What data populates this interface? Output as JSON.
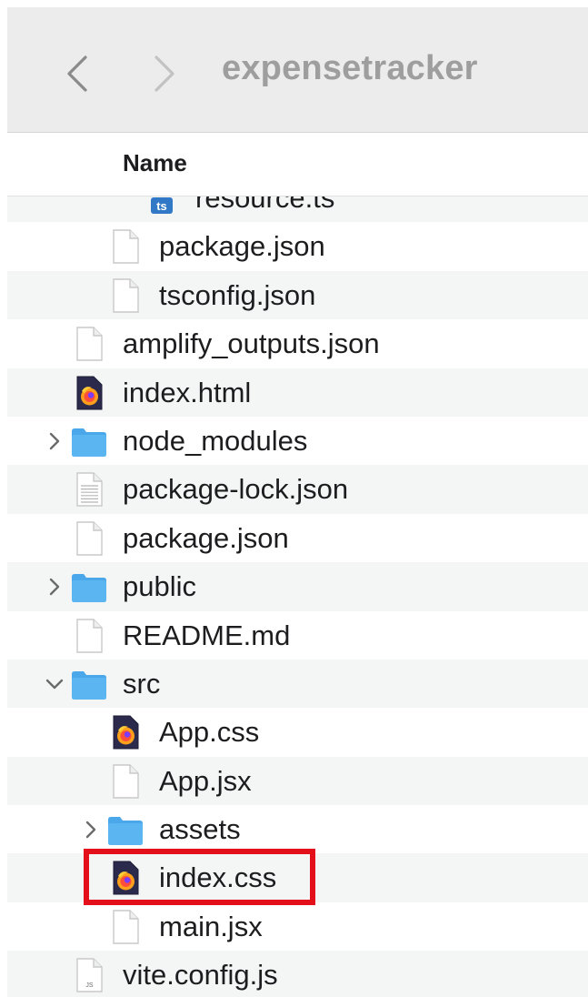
{
  "window": {
    "title": "expensetracker"
  },
  "list_header": {
    "name_label": "Name"
  },
  "files": [
    {
      "name": "resource.ts",
      "depth": 2,
      "icon": "typescript-file-icon",
      "expandable": false
    },
    {
      "name": "package.json",
      "depth": 1,
      "icon": "document-icon",
      "expandable": false
    },
    {
      "name": "tsconfig.json",
      "depth": 1,
      "icon": "document-icon",
      "expandable": false
    },
    {
      "name": "amplify_outputs.json",
      "depth": 0,
      "icon": "document-icon",
      "expandable": false
    },
    {
      "name": "index.html",
      "depth": 0,
      "icon": "firefox-file-icon",
      "expandable": false
    },
    {
      "name": "node_modules",
      "depth": 0,
      "icon": "folder-icon",
      "expandable": true,
      "expanded": false
    },
    {
      "name": "package-lock.json",
      "depth": 0,
      "icon": "text-document-icon",
      "expandable": false
    },
    {
      "name": "package.json",
      "depth": 0,
      "icon": "document-icon",
      "expandable": false
    },
    {
      "name": "public",
      "depth": 0,
      "icon": "folder-icon",
      "expandable": true,
      "expanded": false
    },
    {
      "name": "README.md",
      "depth": 0,
      "icon": "document-icon",
      "expandable": false
    },
    {
      "name": "src",
      "depth": 0,
      "icon": "folder-icon",
      "expandable": true,
      "expanded": true
    },
    {
      "name": "App.css",
      "depth": 1,
      "icon": "firefox-file-icon",
      "expandable": false
    },
    {
      "name": "App.jsx",
      "depth": 1,
      "icon": "document-icon",
      "expandable": false
    },
    {
      "name": "assets",
      "depth": 1,
      "icon": "folder-icon",
      "expandable": true,
      "expanded": false
    },
    {
      "name": "index.css",
      "depth": 1,
      "icon": "firefox-file-icon",
      "expandable": false,
      "highlighted": true
    },
    {
      "name": "main.jsx",
      "depth": 1,
      "icon": "document-icon",
      "expandable": false
    },
    {
      "name": "vite.config.js",
      "depth": 0,
      "icon": "js-file-icon",
      "expandable": false,
      "badge": "JS"
    }
  ],
  "colors": {
    "toolbar": "#ececec",
    "row_alt": "#f4f6f6",
    "folder": "#5ab5f0",
    "highlight": "#e3101c"
  }
}
